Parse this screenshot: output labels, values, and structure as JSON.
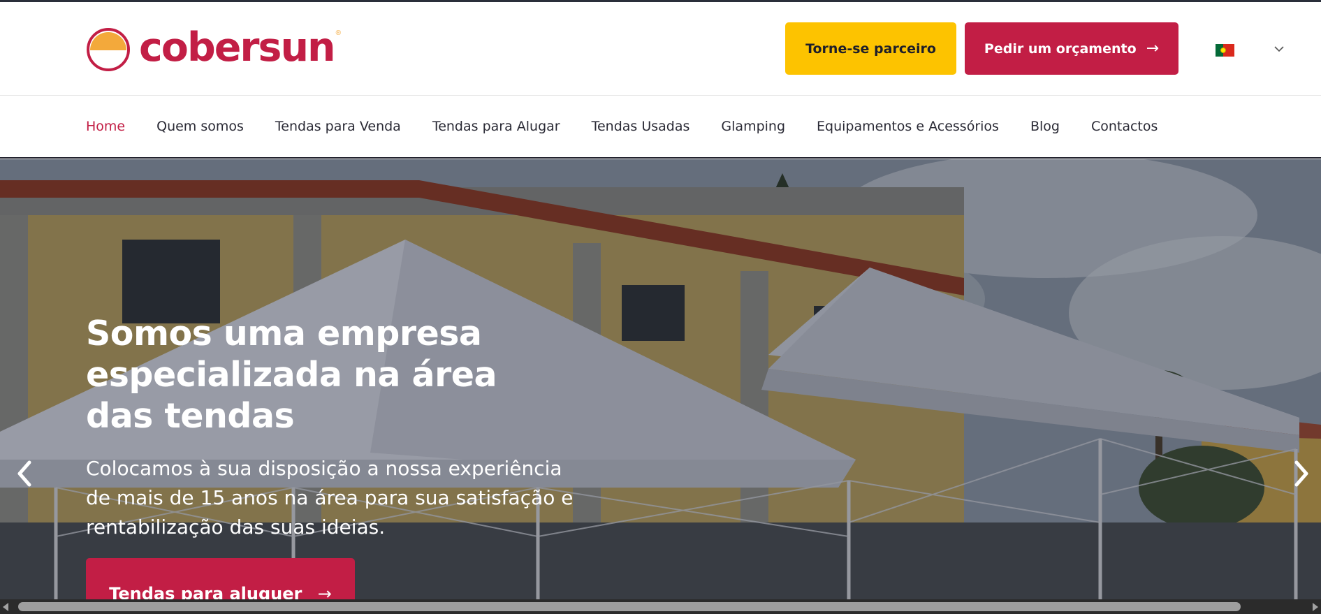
{
  "brand": {
    "name": "cobersun",
    "registered_mark": "®",
    "primary_color": "#c21e45",
    "accent_color": "#fdc300",
    "logo_icon": "sun-half-icon"
  },
  "header": {
    "partner_button": "Torne-se parceiro",
    "quote_button": "Pedir um orçamento",
    "quote_arrow": "→",
    "language_flag": "portugal-flag-icon",
    "language_chevron": "chevron-down-icon"
  },
  "nav": {
    "items": [
      {
        "label": "Home",
        "active": true
      },
      {
        "label": "Quem somos"
      },
      {
        "label": "Tendas para Venda"
      },
      {
        "label": "Tendas para Alugar"
      },
      {
        "label": "Tendas Usadas"
      },
      {
        "label": "Glamping"
      },
      {
        "label": "Equipamentos e Acessórios"
      },
      {
        "label": "Blog"
      },
      {
        "label": "Contactos"
      }
    ]
  },
  "hero": {
    "title": "Somos uma empresa especializada na área das tendas",
    "subtitle": "Colocamos à sua disposição a nossa experiência de mais de 15 anos na área para sua satisfação e rentabilização das suas ideias.",
    "cta_label": "Tendas para aluguer",
    "cta_arrow": "→",
    "prev_icon": "chevron-left-icon",
    "next_icon": "chevron-right-icon"
  }
}
